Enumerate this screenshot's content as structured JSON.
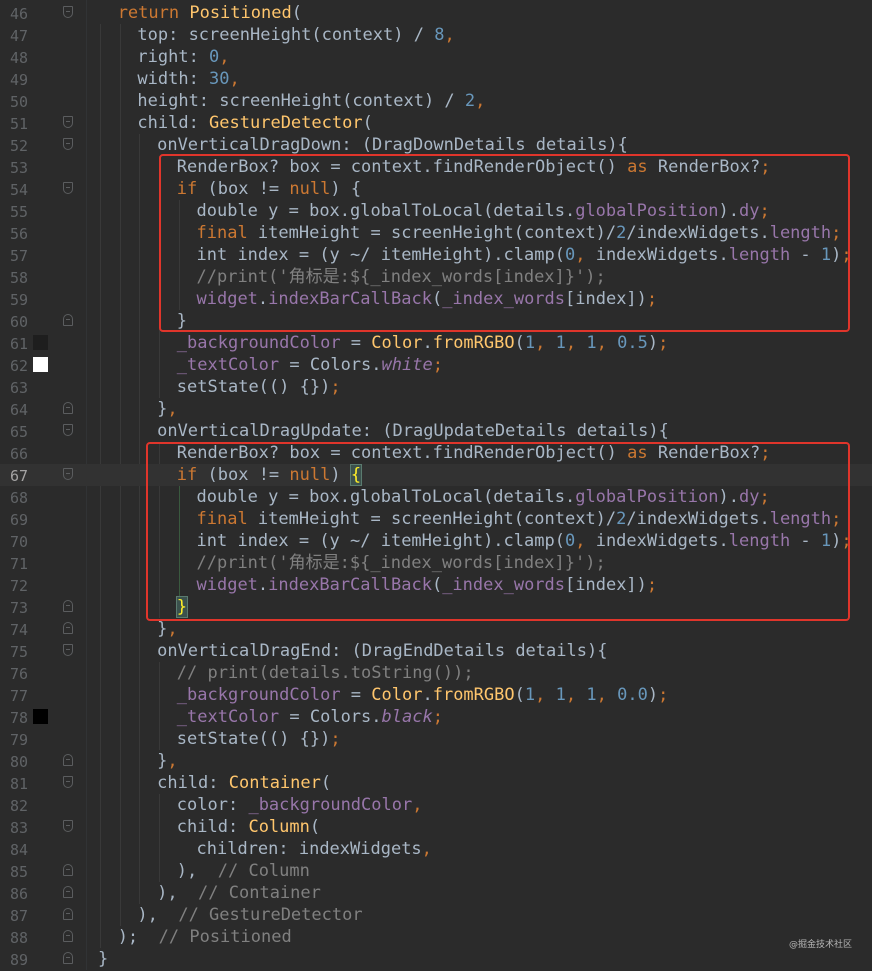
{
  "editor": {
    "current_line": 67,
    "watermark": "@掘金技术社区",
    "colors": {
      "background": "#2b2b2b",
      "keyword": "#cc7832",
      "class": "#ffc66d",
      "number": "#6897bb",
      "property": "#9876aa",
      "comment": "#808080",
      "text": "#a9b7c6",
      "highlight_box": "#e0352b"
    },
    "lines": [
      {
        "n": "46",
        "indent": 1,
        "fold": "start",
        "code": [
          [
            "kw",
            "return "
          ],
          [
            "cls",
            "Positioned"
          ],
          [
            "",
            "("
          ]
        ]
      },
      {
        "n": "47",
        "indent": 2,
        "code": [
          [
            "",
            "top: screenHeight(context) / "
          ],
          [
            "num",
            "8"
          ],
          [
            "kw",
            ","
          ]
        ]
      },
      {
        "n": "48",
        "indent": 2,
        "code": [
          [
            "",
            "right: "
          ],
          [
            "num",
            "0"
          ],
          [
            "kw",
            ","
          ]
        ]
      },
      {
        "n": "49",
        "indent": 2,
        "code": [
          [
            "",
            "width: "
          ],
          [
            "num",
            "30"
          ],
          [
            "kw",
            ","
          ]
        ]
      },
      {
        "n": "50",
        "indent": 2,
        "code": [
          [
            "",
            "height: screenHeight(context) / "
          ],
          [
            "num",
            "2"
          ],
          [
            "kw",
            ","
          ]
        ]
      },
      {
        "n": "51",
        "indent": 2,
        "fold": "start",
        "code": [
          [
            "",
            "child: "
          ],
          [
            "cls",
            "GestureDetector"
          ],
          [
            "",
            "("
          ]
        ]
      },
      {
        "n": "52",
        "indent": 3,
        "fold": "start",
        "code": [
          [
            "",
            "onVerticalDragDown: (DragDownDetails details){"
          ]
        ]
      },
      {
        "n": "53",
        "indent": 4,
        "code": [
          [
            "",
            "RenderBox? box = context.findRenderObject() "
          ],
          [
            "kw",
            "as"
          ],
          [
            "",
            " RenderBox?"
          ],
          [
            "kw",
            ";"
          ]
        ]
      },
      {
        "n": "54",
        "indent": 4,
        "fold": "start",
        "code": [
          [
            "kw",
            "if"
          ],
          [
            "",
            " (box != "
          ],
          [
            "kw",
            "null"
          ],
          [
            "",
            ") {"
          ]
        ]
      },
      {
        "n": "55",
        "indent": 5,
        "code": [
          [
            "",
            "double y = box.globalToLocal(details."
          ],
          [
            "prop",
            "globalPosition"
          ],
          [
            "",
            ")."
          ],
          [
            "prop",
            "dy"
          ],
          [
            "kw",
            ";"
          ]
        ]
      },
      {
        "n": "56",
        "indent": 5,
        "code": [
          [
            "kw",
            "final"
          ],
          [
            "",
            " itemHeight = screenHeight(context)/"
          ],
          [
            "num",
            "2"
          ],
          [
            "",
            "/indexWidgets."
          ],
          [
            "prop",
            "length"
          ],
          [
            "kw",
            ";"
          ]
        ]
      },
      {
        "n": "57",
        "indent": 5,
        "code": [
          [
            "",
            "int index = (y ~/ itemHeight).clamp("
          ],
          [
            "num",
            "0"
          ],
          [
            "kw",
            ","
          ],
          [
            "",
            " indexWidgets."
          ],
          [
            "prop",
            "length"
          ],
          [
            "",
            " - "
          ],
          [
            "num",
            "1"
          ],
          [
            "",
            ")"
          ],
          [
            "kw",
            ";"
          ]
        ]
      },
      {
        "n": "58",
        "indent": 5,
        "code": [
          [
            "cm",
            "//print('角标是:${_index_words[index]}');"
          ]
        ]
      },
      {
        "n": "59",
        "indent": 5,
        "code": [
          [
            "prop",
            "widget"
          ],
          [
            "",
            "."
          ],
          [
            "prop",
            "indexBarCallBack"
          ],
          [
            "",
            "("
          ],
          [
            "prop",
            "_index_words"
          ],
          [
            "",
            "[index])"
          ],
          [
            "kw",
            ";"
          ]
        ]
      },
      {
        "n": "60",
        "indent": 4,
        "fold": "end",
        "code": [
          [
            "",
            "}"
          ]
        ]
      },
      {
        "n": "61",
        "indent": 4,
        "swatch": "#1e1e1e",
        "code": [
          [
            "prop",
            "_backgroundColor"
          ],
          [
            "",
            " = "
          ],
          [
            "cls",
            "Color"
          ],
          [
            "",
            "."
          ],
          [
            "cls",
            "fromRGBO"
          ],
          [
            "",
            "("
          ],
          [
            "num",
            "1"
          ],
          [
            "kw",
            ","
          ],
          [
            " ",
            ""
          ],
          [
            "num",
            "1"
          ],
          [
            "kw",
            ","
          ],
          [
            " ",
            ""
          ],
          [
            "num",
            "1"
          ],
          [
            "kw",
            ","
          ],
          [
            " ",
            ""
          ],
          [
            "num",
            "0.5"
          ],
          [
            "",
            ")"
          ],
          [
            "kw",
            ";"
          ]
        ]
      },
      {
        "n": "62",
        "indent": 4,
        "swatch": "#ffffff",
        "code": [
          [
            "prop",
            "_textColor"
          ],
          [
            "",
            " = Colors."
          ],
          [
            "ital",
            "white"
          ],
          [
            "kw",
            ";"
          ]
        ]
      },
      {
        "n": "63",
        "indent": 4,
        "code": [
          [
            "",
            "setState(() {})"
          ],
          [
            "kw",
            ";"
          ]
        ]
      },
      {
        "n": "64",
        "indent": 3,
        "fold": "end",
        "code": [
          [
            "",
            "}"
          ],
          [
            "kw",
            ","
          ]
        ]
      },
      {
        "n": "65",
        "indent": 3,
        "fold": "start",
        "code": [
          [
            "",
            "onVerticalDragUpdate: (DragUpdateDetails details){"
          ]
        ]
      },
      {
        "n": "66",
        "indent": 4,
        "code": [
          [
            "",
            "RenderBox? box = context.findRenderObject() "
          ],
          [
            "kw",
            "as"
          ],
          [
            "",
            " RenderBox?"
          ],
          [
            "kw",
            ";"
          ]
        ]
      },
      {
        "n": "67",
        "indent": 4,
        "fold": "start",
        "code": [
          [
            "kw",
            "if"
          ],
          [
            "",
            " (box != "
          ],
          [
            "kw",
            "null"
          ],
          [
            "",
            ") "
          ],
          [
            "brk",
            "{"
          ]
        ]
      },
      {
        "n": "68",
        "indent": 5,
        "code": [
          [
            "",
            "double y = box.globalToLocal(details."
          ],
          [
            "prop",
            "globalPosition"
          ],
          [
            "",
            ")."
          ],
          [
            "prop",
            "dy"
          ],
          [
            "kw",
            ";"
          ]
        ]
      },
      {
        "n": "69",
        "indent": 5,
        "code": [
          [
            "kw",
            "final"
          ],
          [
            "",
            " itemHeight = screenHeight(context)/"
          ],
          [
            "num",
            "2"
          ],
          [
            "",
            "/indexWidgets."
          ],
          [
            "prop",
            "length"
          ],
          [
            "kw",
            ";"
          ]
        ]
      },
      {
        "n": "70",
        "indent": 5,
        "code": [
          [
            "",
            "int index = (y ~/ itemHeight).clamp("
          ],
          [
            "num",
            "0"
          ],
          [
            "kw",
            ","
          ],
          [
            "",
            " indexWidgets."
          ],
          [
            "prop",
            "length"
          ],
          [
            "",
            " - "
          ],
          [
            "num",
            "1"
          ],
          [
            "",
            ")"
          ],
          [
            "kw",
            ";"
          ]
        ]
      },
      {
        "n": "71",
        "indent": 5,
        "code": [
          [
            "cm",
            "//print('角标是:${_index_words[index]}');"
          ]
        ]
      },
      {
        "n": "72",
        "indent": 5,
        "code": [
          [
            "prop",
            "widget"
          ],
          [
            "",
            "."
          ],
          [
            "prop",
            "indexBarCallBack"
          ],
          [
            "",
            "("
          ],
          [
            "prop",
            "_index_words"
          ],
          [
            "",
            "[index])"
          ],
          [
            "kw",
            ";"
          ]
        ]
      },
      {
        "n": "73",
        "indent": 4,
        "fold": "end",
        "code": [
          [
            "brk",
            "}"
          ]
        ]
      },
      {
        "n": "74",
        "indent": 3,
        "fold": "end",
        "code": [
          [
            "",
            "}"
          ],
          [
            "kw",
            ","
          ]
        ]
      },
      {
        "n": "75",
        "indent": 3,
        "fold": "start",
        "code": [
          [
            "",
            "onVerticalDragEnd: (DragEndDetails details){"
          ]
        ]
      },
      {
        "n": "76",
        "indent": 4,
        "code": [
          [
            "cm",
            "// print(details.toString());"
          ]
        ]
      },
      {
        "n": "77",
        "indent": 4,
        "code": [
          [
            "prop",
            "_backgroundColor"
          ],
          [
            "",
            " = "
          ],
          [
            "cls",
            "Color"
          ],
          [
            "",
            "."
          ],
          [
            "cls",
            "fromRGBO"
          ],
          [
            "",
            "("
          ],
          [
            "num",
            "1"
          ],
          [
            "kw",
            ","
          ],
          [
            " ",
            ""
          ],
          [
            "num",
            "1"
          ],
          [
            "kw",
            ","
          ],
          [
            " ",
            ""
          ],
          [
            "num",
            "1"
          ],
          [
            "kw",
            ","
          ],
          [
            " ",
            ""
          ],
          [
            "num",
            "0.0"
          ],
          [
            "",
            ")"
          ],
          [
            "kw",
            ";"
          ]
        ]
      },
      {
        "n": "78",
        "indent": 4,
        "swatch": "#000000",
        "code": [
          [
            "prop",
            "_textColor"
          ],
          [
            "",
            " = Colors."
          ],
          [
            "ital",
            "black"
          ],
          [
            "kw",
            ";"
          ]
        ]
      },
      {
        "n": "79",
        "indent": 4,
        "code": [
          [
            "",
            "setState(() {})"
          ],
          [
            "kw",
            ";"
          ]
        ]
      },
      {
        "n": "80",
        "indent": 3,
        "fold": "end",
        "code": [
          [
            "",
            "}"
          ],
          [
            "kw",
            ","
          ]
        ]
      },
      {
        "n": "81",
        "indent": 3,
        "fold": "start",
        "code": [
          [
            "",
            "child: "
          ],
          [
            "cls",
            "Container"
          ],
          [
            "",
            "("
          ]
        ]
      },
      {
        "n": "82",
        "indent": 4,
        "code": [
          [
            "",
            "color: "
          ],
          [
            "prop",
            "_backgroundColor"
          ],
          [
            "kw",
            ","
          ]
        ]
      },
      {
        "n": "83",
        "indent": 4,
        "fold": "start",
        "code": [
          [
            "",
            "child: "
          ],
          [
            "cls",
            "Column"
          ],
          [
            "",
            "("
          ]
        ]
      },
      {
        "n": "84",
        "indent": 5,
        "code": [
          [
            "",
            "children: indexWidgets"
          ],
          [
            "kw",
            ","
          ]
        ]
      },
      {
        "n": "85",
        "indent": 4,
        "fold": "end",
        "code": [
          [
            "",
            "),  "
          ],
          [
            "cm",
            "// Column"
          ]
        ]
      },
      {
        "n": "86",
        "indent": 3,
        "fold": "end",
        "code": [
          [
            "",
            "),  "
          ],
          [
            "cm",
            "// Container"
          ]
        ]
      },
      {
        "n": "87",
        "indent": 2,
        "fold": "end",
        "code": [
          [
            "",
            "),  "
          ],
          [
            "cm",
            "// GestureDetector"
          ]
        ]
      },
      {
        "n": "88",
        "indent": 1,
        "fold": "end",
        "code": [
          [
            "",
            ");  "
          ],
          [
            "cm",
            "// Positioned"
          ]
        ]
      },
      {
        "n": "89",
        "indent": 0,
        "fold": "end",
        "code": [
          [
            "",
            "}"
          ]
        ]
      }
    ]
  }
}
